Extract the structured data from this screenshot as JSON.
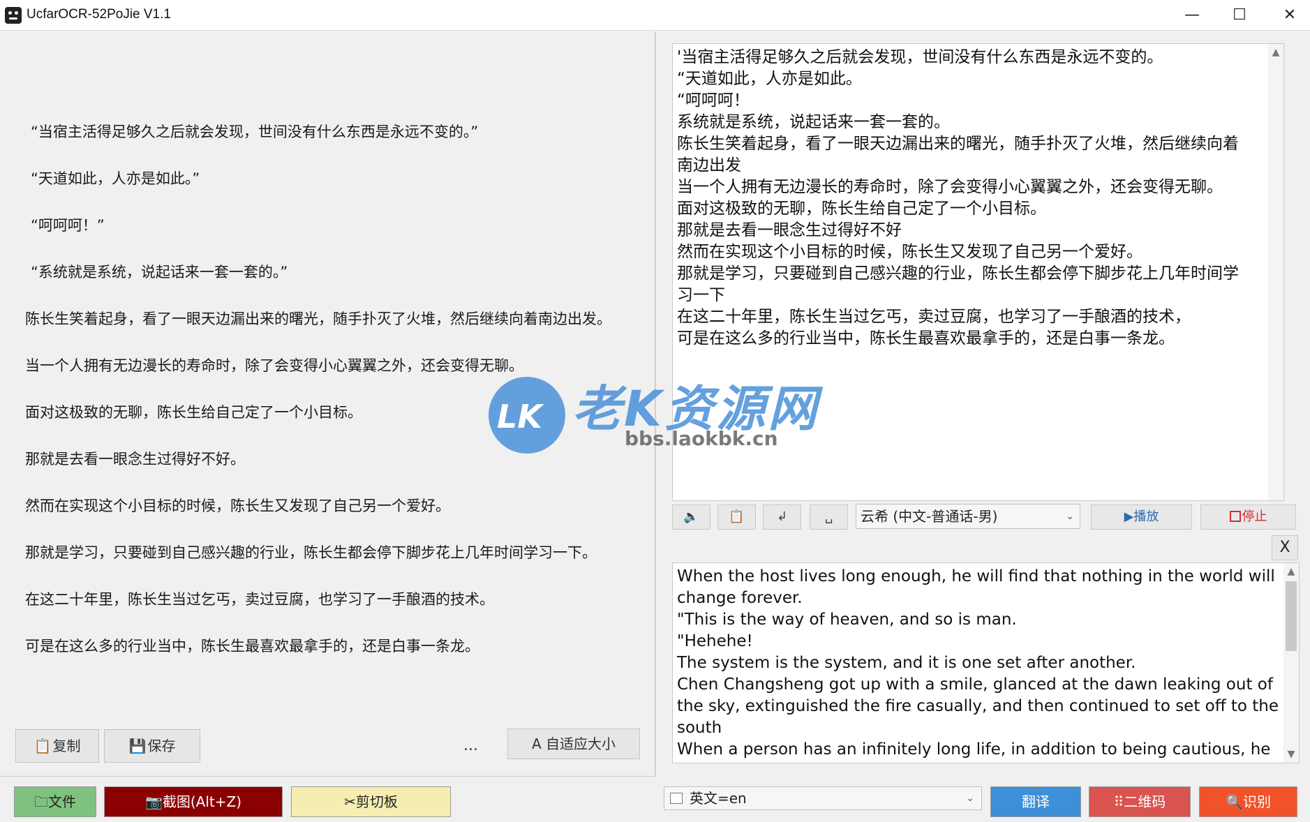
{
  "window": {
    "title": "UcfarOCR-52PoJie V1.1",
    "minimize_glyph": "—",
    "maximize_glyph": "☐",
    "close_glyph": "✕"
  },
  "source_text": {
    "lines": [
      "“当宿主活得足够久之后就会发现，世间没有什么东西是永远不变的。”",
      "“天道如此，人亦是如此。”",
      "“呵呵呵！”",
      "“系统就是系统，说起话来一套一套的。”",
      "陈长生笑着起身，看了一眼天边漏出来的曙光，随手扑灭了火堆，然后继续向着南边出发。",
      "当一个人拥有无边漫长的寿命时，除了会变得小心翼翼之外，还会变得无聊。",
      "面对这极致的无聊，陈长生给自己定了一个小目标。",
      "那就是去看一眼念生过得好不好。",
      "然而在实现这个小目标的时候，陈长生又发现了自己另一个爱好。",
      "那就是学习，只要碰到自己感兴趣的行业，陈长生都会停下脚步花上几年时间学习一下。",
      "在这二十年里，陈长生当过乞丐，卖过豆腐，也学习了一手酿酒的技术。",
      "可是在这么多的行业当中，陈长生最喜欢最拿手的，还是白事一条龙。"
    ]
  },
  "left_toolbar": {
    "copy_label": "复制",
    "save_label": "保存",
    "ellipsis": "...",
    "autosize_label": "A 自适应大小"
  },
  "ocr_result": {
    "lines": [
      "'当宿主活得足够久之后就会发现，世间没有什么东西是永远不变的。",
      "“天道如此，人亦是如此。",
      "“呵呵呵！",
      "系统就是系统，说起话来一套一套的。",
      "陈长生笑着起身，看了一眼天边漏出来的曙光，随手扑灭了火堆，然后继续向着",
      "南边出发",
      "当一个人拥有无边漫长的寿命时，除了会变得小心翼翼之外，还会变得无聊。",
      "面对这极致的无聊，陈长生给自己定了一个小目标。",
      "那就是去看一眼念生过得好不好",
      "然而在实现这个小目标的时候，陈长生又发现了自己另一个爱好。",
      "那就是学习，只要碰到自己感兴趣的行业，陈长生都会停下脚步花上几年时间学",
      "习一下",
      "在这二十年里，陈长生当过乞丐，卖过豆腐，也学习了一手酿酒的技术，",
      "可是在这么多的行业当中，陈长生最喜欢最拿手的，还是白事一条龙。"
    ]
  },
  "tts_toolbar": {
    "speaker_glyph": "🔈",
    "clipboard_glyph": "📋",
    "enter_glyph": "↲",
    "space_glyph": "␣",
    "voice_selected": "云希 (中文-普通话-男)",
    "play_label": "▶播放",
    "stop_label": "停止"
  },
  "translation_panel": {
    "close_label": "X",
    "lines": [
      "When the host lives long enough, he will find that nothing in the world will",
      "change forever.",
      "\"This is the way of heaven, and so is man.",
      "\"Hehehe!",
      "The system is the system, and it is one set after another.",
      "Chen Changsheng got up with a smile, glanced at the dawn leaking out of",
      "the sky, extinguished the fire casually, and then continued to set off to the",
      "south",
      "When a person has an infinitely long life, in addition to being cautious, he"
    ]
  },
  "bottom_bar": {
    "file_label": "文件",
    "capture_label": "截图(Alt+Z)",
    "clipboard_label": "剪切板",
    "target_language": "英文=en",
    "translate_label": "翻译",
    "qrcode_label": "二维码",
    "recognize_label": "识别"
  },
  "watermark": {
    "badge": "LK",
    "title": "老K资源网",
    "url": "bbs.laokbk.cn"
  },
  "colors": {
    "file_btn": "#7fc27f",
    "capture_btn": "#8b0000",
    "clipboard_btn": "#f5eeb0",
    "translate_btn": "#3d8fd8",
    "qrcode_btn": "#d9534f",
    "recognize_btn": "#f2522a"
  }
}
